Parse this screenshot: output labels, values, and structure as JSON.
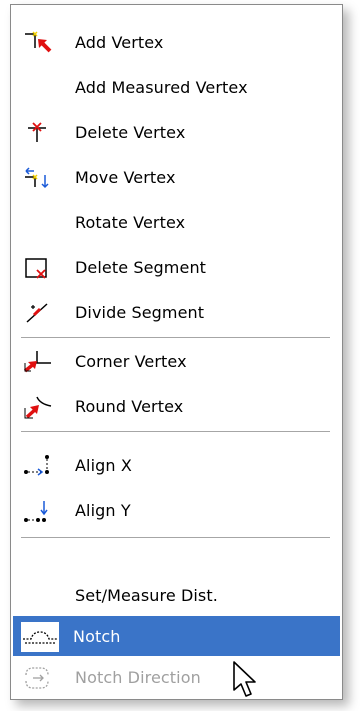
{
  "menu": {
    "items": [
      {
        "label": "Add Vertex",
        "icon": "add-vertex-icon"
      },
      {
        "label": "Add Measured Vertex",
        "icon": ""
      },
      {
        "label": "Delete Vertex",
        "icon": "delete-vertex-icon"
      },
      {
        "label": "Move Vertex",
        "icon": "move-vertex-icon"
      },
      {
        "label": "Rotate Vertex",
        "icon": ""
      },
      {
        "label": "Delete Segment",
        "icon": "delete-segment-icon"
      },
      {
        "label": "Divide Segment",
        "icon": "divide-segment-icon"
      },
      {
        "label": "Corner Vertex",
        "icon": "corner-vertex-icon"
      },
      {
        "label": "Round Vertex",
        "icon": "round-vertex-icon"
      },
      {
        "label": "Align X",
        "icon": "align-x-icon"
      },
      {
        "label": "Align Y",
        "icon": "align-y-icon"
      },
      {
        "label": "Set/Measure Dist.",
        "icon": ""
      },
      {
        "label": "Notch",
        "icon": "notch-icon",
        "state": "selected"
      },
      {
        "label": "Notch Direction",
        "icon": "notch-direction-icon",
        "state": "disabled"
      }
    ]
  },
  "colors": {
    "selection": "#3a74c8",
    "accent_red": "#e01010",
    "accent_blue": "#1a5ad8",
    "accent_yellow": "#f2d000",
    "disabled_text": "#a0a0a0"
  }
}
